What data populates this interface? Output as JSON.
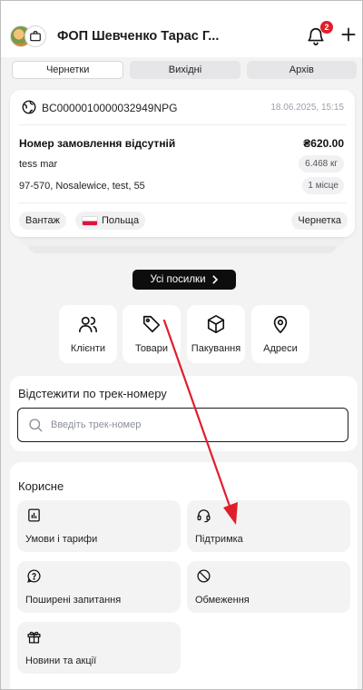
{
  "header": {
    "company_name": "ФОП Шевченко Тарас Г...",
    "notification_count": "2"
  },
  "tabs": [
    {
      "label": "Чернетки",
      "active": true
    },
    {
      "label": "Вихідні",
      "active": false
    },
    {
      "label": "Архів",
      "active": false
    }
  ],
  "parcel": {
    "id": "BC0000010000032949NPG",
    "date": "18.06.2025, 15:15",
    "order_status": "Номер замовлення відсутній",
    "price": "₴620.00",
    "recipient": "tess mar",
    "weight": "6.468 кг",
    "address": "97-570, Nosalewice, test, 55",
    "places": "1 місце",
    "type": "Вантаж",
    "country": "Польща",
    "status": "Чернетка"
  },
  "all_parcels_label": "Усі посилки",
  "quick_actions": [
    {
      "label": "Клієнти",
      "icon": "clients-icon"
    },
    {
      "label": "Товари",
      "icon": "tag-icon"
    },
    {
      "label": "Пакування",
      "icon": "box-icon"
    },
    {
      "label": "Адреси",
      "icon": "map-pin-icon"
    }
  ],
  "track": {
    "title": "Відстежити по трек-номеру",
    "placeholder": "Введіть трек-номер",
    "value": ""
  },
  "useful": {
    "title": "Корисне",
    "items": [
      {
        "label": "Умови і тарифи",
        "icon": "chart-doc-icon"
      },
      {
        "label": "Підтримка",
        "icon": "headset-icon"
      },
      {
        "label": "Поширені запитання",
        "icon": "help-bubble-icon"
      },
      {
        "label": "Обмеження",
        "icon": "forbidden-icon"
      },
      {
        "label": "Новини та акції",
        "icon": "gift-icon"
      }
    ]
  },
  "colors": {
    "accent_dark": "#0d0d0d",
    "badge_red": "#e01e2b",
    "annotation_arrow": "#e01e2b",
    "page_bg": "#f3f3f4"
  }
}
